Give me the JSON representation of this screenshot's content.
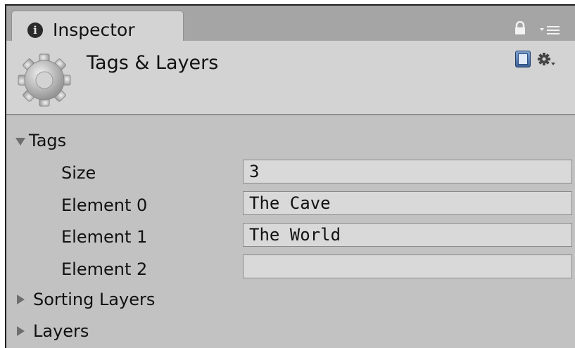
{
  "tab": {
    "title": "Inspector",
    "icon": "info-icon"
  },
  "tabbar_icons": [
    "lock-icon",
    "panel-menu-icon"
  ],
  "header": {
    "title": "Tags & Layers",
    "icon": "gear-icon",
    "right_icons": [
      "help-book-icon",
      "settings-gear-icon"
    ]
  },
  "tags": {
    "label": "Tags",
    "expanded": true,
    "size_label": "Size",
    "size_value": "3",
    "elements": [
      {
        "label": "Element 0",
        "value": "The Cave"
      },
      {
        "label": "Element 1",
        "value": "The World"
      },
      {
        "label": "Element 2",
        "value": ""
      }
    ]
  },
  "sorting_layers": {
    "label": "Sorting Layers",
    "expanded": false
  },
  "layers": {
    "label": "Layers",
    "expanded": false
  },
  "colors": {
    "panel_bg": "#c2c2c2",
    "header_bg": "#d3d3d3",
    "field_bg": "#d9d9d9"
  }
}
